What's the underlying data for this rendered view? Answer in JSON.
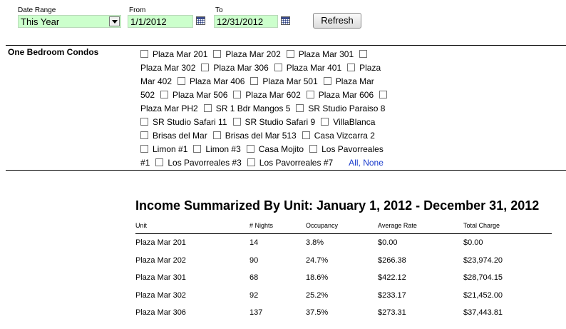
{
  "filters": {
    "date_range": {
      "label": "Date Range",
      "value": "This Year"
    },
    "from": {
      "label": "From",
      "value": "1/1/2012"
    },
    "to": {
      "label": "To",
      "value": "12/31/2012"
    },
    "refresh_label": "Refresh"
  },
  "group": {
    "label": "One Bedroom Condos",
    "lines": [
      [
        {
          "cb": true,
          "t": "Plaza Mar 201"
        },
        {
          "cb": true,
          "t": "Plaza Mar 202"
        },
        {
          "cb": true,
          "t": "Plaza Mar 301"
        },
        {
          "cb": true,
          "t": ""
        }
      ],
      [
        {
          "cb": false,
          "t": "Plaza Mar 302"
        },
        {
          "cb": true,
          "t": "Plaza Mar 306"
        },
        {
          "cb": true,
          "t": "Plaza Mar 401"
        },
        {
          "cb": true,
          "t": "Plaza"
        }
      ],
      [
        {
          "cb": false,
          "t": "Mar 402"
        },
        {
          "cb": true,
          "t": "Plaza Mar 406"
        },
        {
          "cb": true,
          "t": "Plaza Mar 501"
        },
        {
          "cb": true,
          "t": "Plaza Mar"
        }
      ],
      [
        {
          "cb": false,
          "t": "502"
        },
        {
          "cb": true,
          "t": "Plaza Mar 506"
        },
        {
          "cb": true,
          "t": "Plaza Mar 602"
        },
        {
          "cb": true,
          "t": "Plaza Mar 606"
        },
        {
          "cb": true,
          "t": ""
        }
      ],
      [
        {
          "cb": false,
          "t": "Plaza Mar PH2"
        },
        {
          "cb": true,
          "t": "SR 1 Bdr Mangos 5"
        },
        {
          "cb": true,
          "t": "SR Studio Paraiso 8"
        }
      ],
      [
        {
          "cb": true,
          "t": "SR Studio Safari 11"
        },
        {
          "cb": true,
          "t": "SR Studio Safari 9"
        },
        {
          "cb": true,
          "t": "VillaBlanca"
        }
      ],
      [
        {
          "cb": true,
          "t": "Brisas del Mar"
        },
        {
          "cb": true,
          "t": "Brisas del Mar 513"
        },
        {
          "cb": true,
          "t": "Casa Vizcarra 2"
        }
      ],
      [
        {
          "cb": true,
          "t": "Limon #1"
        },
        {
          "cb": true,
          "t": "Limon #3"
        },
        {
          "cb": true,
          "t": "Casa Mojito"
        },
        {
          "cb": true,
          "t": "Los Pavorreales"
        }
      ],
      [
        {
          "cb": false,
          "t": "#1"
        },
        {
          "cb": true,
          "t": "Los Pavorreales #3"
        },
        {
          "cb": true,
          "t": "Los Pavorreales #7"
        }
      ]
    ],
    "all_label": "All",
    "none_label": "None"
  },
  "report": {
    "title": "Income Summarized By Unit: January 1, 2012 - December 31, 2012",
    "columns": [
      "Unit",
      "# Nights",
      "Occupancy",
      "Average Rate",
      "Total Charge"
    ],
    "rows": [
      [
        "Plaza Mar 201",
        "14",
        "3.8%",
        "$0.00",
        "$0.00"
      ],
      [
        "Plaza Mar 202",
        "90",
        "24.7%",
        "$266.38",
        "$23,974.20"
      ],
      [
        "Plaza Mar 301",
        "68",
        "18.6%",
        "$422.12",
        "$28,704.15"
      ],
      [
        "Plaza Mar 302",
        "92",
        "25.2%",
        "$233.17",
        "$21,452.00"
      ],
      [
        "Plaza Mar 306",
        "137",
        "37.5%",
        "$273.31",
        "$37,443.81"
      ]
    ]
  }
}
